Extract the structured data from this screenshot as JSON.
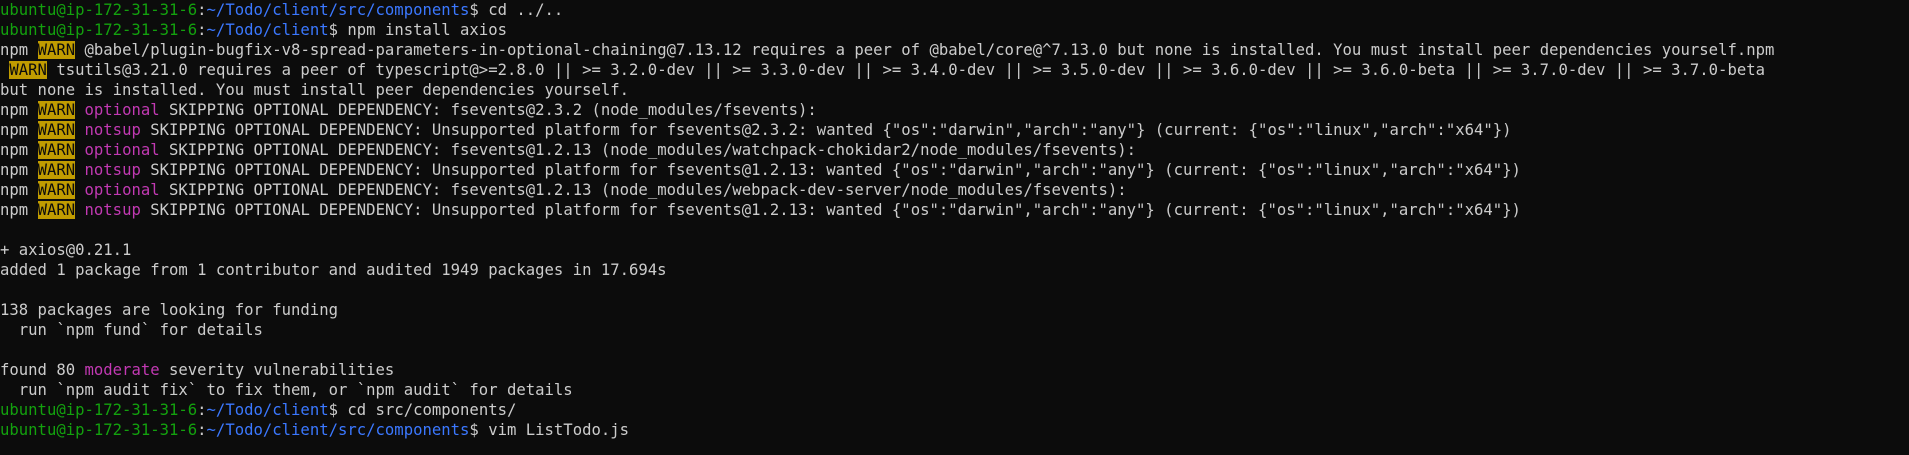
{
  "terminal": {
    "lines": [
      [
        {
          "t": "ubuntu@ip-172-31-31-6",
          "c": "green"
        },
        {
          "t": ":",
          "c": "white"
        },
        {
          "t": "~/Todo/client/src/components",
          "c": "blue"
        },
        {
          "t": "$ cd ../..",
          "c": "white"
        }
      ],
      [
        {
          "t": "ubuntu@ip-172-31-31-6",
          "c": "green"
        },
        {
          "t": ":",
          "c": "white"
        },
        {
          "t": "~/Todo/client",
          "c": "blue"
        },
        {
          "t": "$ npm install axios",
          "c": "white"
        }
      ],
      [
        {
          "t": "npm ",
          "c": "white"
        },
        {
          "t": "WARN",
          "c": "warn"
        },
        {
          "t": " @babel/plugin-bugfix-v8-spread-parameters-in-optional-chaining@7.13.12 requires a peer of @babel/core@^7.13.0 but none is installed. You must install peer dependencies yourself.npm",
          "c": "white"
        }
      ],
      [
        {
          "t": " ",
          "c": "white"
        },
        {
          "t": "WARN",
          "c": "warn"
        },
        {
          "t": " tsutils@3.21.0 requires a peer of typescript@>=2.8.0 || >= 3.2.0-dev || >= 3.3.0-dev || >= 3.4.0-dev || >= 3.5.0-dev || >= 3.6.0-dev || >= 3.6.0-beta || >= 3.7.0-dev || >= 3.7.0-beta",
          "c": "white"
        }
      ],
      [
        {
          "t": "but none is installed. You must install peer dependencies yourself.",
          "c": "white"
        }
      ],
      [
        {
          "t": "npm ",
          "c": "white"
        },
        {
          "t": "WARN",
          "c": "warn"
        },
        {
          "t": " ",
          "c": "white"
        },
        {
          "t": "optional",
          "c": "magenta"
        },
        {
          "t": " SKIPPING OPTIONAL DEPENDENCY: fsevents@2.3.2 (node_modules/fsevents):",
          "c": "white"
        }
      ],
      [
        {
          "t": "npm ",
          "c": "white"
        },
        {
          "t": "WARN",
          "c": "warn"
        },
        {
          "t": " ",
          "c": "white"
        },
        {
          "t": "notsup",
          "c": "magenta"
        },
        {
          "t": " SKIPPING OPTIONAL DEPENDENCY: Unsupported platform for fsevents@2.3.2: wanted {\"os\":\"darwin\",\"arch\":\"any\"} (current: {\"os\":\"linux\",\"arch\":\"x64\"})",
          "c": "white"
        }
      ],
      [
        {
          "t": "npm ",
          "c": "white"
        },
        {
          "t": "WARN",
          "c": "warn"
        },
        {
          "t": " ",
          "c": "white"
        },
        {
          "t": "optional",
          "c": "magenta"
        },
        {
          "t": " SKIPPING OPTIONAL DEPENDENCY: fsevents@1.2.13 (node_modules/watchpack-chokidar2/node_modules/fsevents):",
          "c": "white"
        }
      ],
      [
        {
          "t": "npm ",
          "c": "white"
        },
        {
          "t": "WARN",
          "c": "warn"
        },
        {
          "t": " ",
          "c": "white"
        },
        {
          "t": "notsup",
          "c": "magenta"
        },
        {
          "t": " SKIPPING OPTIONAL DEPENDENCY: Unsupported platform for fsevents@1.2.13: wanted {\"os\":\"darwin\",\"arch\":\"any\"} (current: {\"os\":\"linux\",\"arch\":\"x64\"})",
          "c": "white"
        }
      ],
      [
        {
          "t": "npm ",
          "c": "white"
        },
        {
          "t": "WARN",
          "c": "warn"
        },
        {
          "t": " ",
          "c": "white"
        },
        {
          "t": "optional",
          "c": "magenta"
        },
        {
          "t": " SKIPPING OPTIONAL DEPENDENCY: fsevents@1.2.13 (node_modules/webpack-dev-server/node_modules/fsevents):",
          "c": "white"
        }
      ],
      [
        {
          "t": "npm ",
          "c": "white"
        },
        {
          "t": "WARN",
          "c": "warn"
        },
        {
          "t": " ",
          "c": "white"
        },
        {
          "t": "notsup",
          "c": "magenta"
        },
        {
          "t": " SKIPPING OPTIONAL DEPENDENCY: Unsupported platform for fsevents@1.2.13: wanted {\"os\":\"darwin\",\"arch\":\"any\"} (current: {\"os\":\"linux\",\"arch\":\"x64\"})",
          "c": "white"
        }
      ],
      [],
      [
        {
          "t": "+ axios@0.21.1",
          "c": "white"
        }
      ],
      [
        {
          "t": "added 1 package from 1 contributor and audited 1949 packages in 17.694s",
          "c": "white"
        }
      ],
      [],
      [
        {
          "t": "138 packages are looking for funding",
          "c": "white"
        }
      ],
      [
        {
          "t": "  run `npm fund` for details",
          "c": "white"
        }
      ],
      [],
      [
        {
          "t": "found 80 ",
          "c": "white"
        },
        {
          "t": "moderate",
          "c": "magenta"
        },
        {
          "t": " severity vulnerabilities",
          "c": "white"
        }
      ],
      [
        {
          "t": "  run `npm audit fix` to fix them, or `npm audit` for details",
          "c": "white"
        }
      ],
      [
        {
          "t": "ubuntu@ip-172-31-31-6",
          "c": "green"
        },
        {
          "t": ":",
          "c": "white"
        },
        {
          "t": "~/Todo/client",
          "c": "blue"
        },
        {
          "t": "$ cd src/components/",
          "c": "white"
        }
      ],
      [
        {
          "t": "ubuntu@ip-172-31-31-6",
          "c": "green"
        },
        {
          "t": ":",
          "c": "white"
        },
        {
          "t": "~/Todo/client/src/components",
          "c": "blue"
        },
        {
          "t": "$ vim ListTodo.js",
          "c": "white"
        }
      ]
    ]
  },
  "colors": {
    "background": "#0c0c0c",
    "green": "#13a10e",
    "blue": "#3b78ff",
    "white": "#cccccc",
    "magenta": "#c239b3",
    "warn_bg": "#c19c00"
  }
}
